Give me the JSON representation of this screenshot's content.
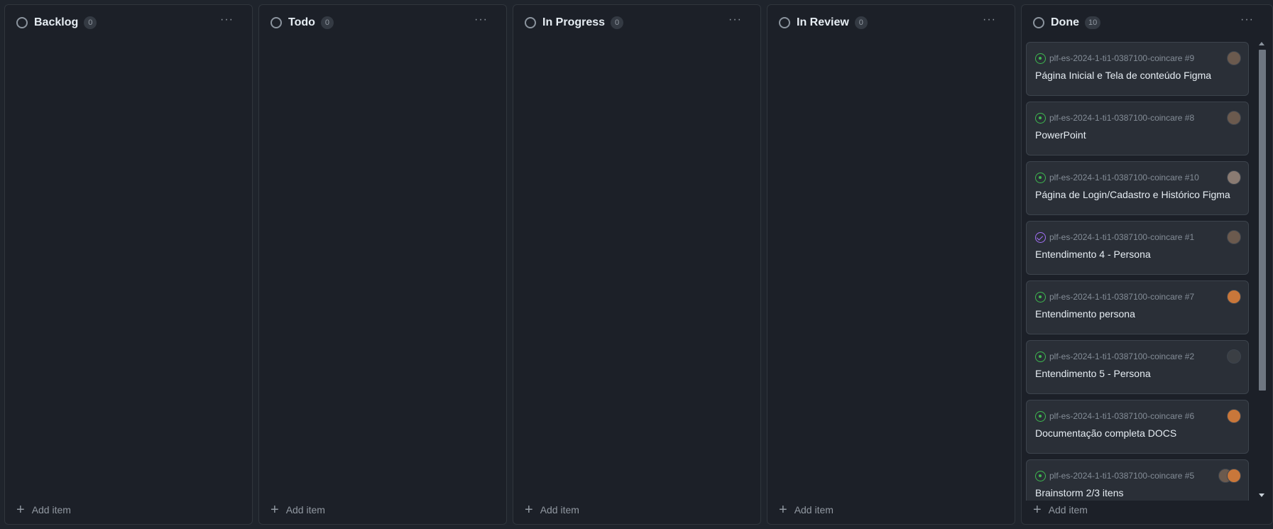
{
  "columns": [
    {
      "title": "Backlog",
      "count": "0",
      "add_label": "Add item"
    },
    {
      "title": "Todo",
      "count": "0",
      "add_label": "Add item"
    },
    {
      "title": "In Progress",
      "count": "0",
      "add_label": "Add item"
    },
    {
      "title": "In Review",
      "count": "0",
      "add_label": "Add item"
    },
    {
      "title": "Done",
      "count": "10",
      "add_label": "Add item"
    }
  ],
  "more_label": "···",
  "add_icon": "+",
  "done_cards": [
    {
      "ref": "plf-es-2024-1-ti1-0387100-coincare #9",
      "title": "Página Inicial e Tela de conteúdo Figma",
      "state": "open",
      "avatar_color": "#6b5a4e"
    },
    {
      "ref": "plf-es-2024-1-ti1-0387100-coincare #8",
      "title": "PowerPoint",
      "state": "open",
      "avatar_color": "#6b5a4e"
    },
    {
      "ref": "plf-es-2024-1-ti1-0387100-coincare #10",
      "title": "Página de Login/Cadastro e Histórico Figma",
      "state": "open",
      "avatar_color": "#8a7b72"
    },
    {
      "ref": "plf-es-2024-1-ti1-0387100-coincare #1",
      "title": "Entendimento 4 - Persona",
      "state": "closed",
      "avatar_color": "#6b5a4e"
    },
    {
      "ref": "plf-es-2024-1-ti1-0387100-coincare #7",
      "title": "Entendimento persona",
      "state": "open",
      "avatar_color": "#c9773a"
    },
    {
      "ref": "plf-es-2024-1-ti1-0387100-coincare #2",
      "title": "Entendimento 5 - Persona",
      "state": "open",
      "avatar_color": "#3b3f44"
    },
    {
      "ref": "plf-es-2024-1-ti1-0387100-coincare #6",
      "title": "Documentação completa DOCS",
      "state": "open",
      "avatar_color": "#c9773a"
    },
    {
      "ref": "plf-es-2024-1-ti1-0387100-coincare #5",
      "title": "Brainstorm 2/3 itens",
      "state": "open",
      "avatar_color": "#c9773a",
      "avatar_color_2": "#6b5a4e"
    }
  ],
  "colors": {
    "open_issue": "#3fb950",
    "closed_issue": "#a371f7",
    "background": "#1f242c",
    "card": "#2a2f37"
  }
}
